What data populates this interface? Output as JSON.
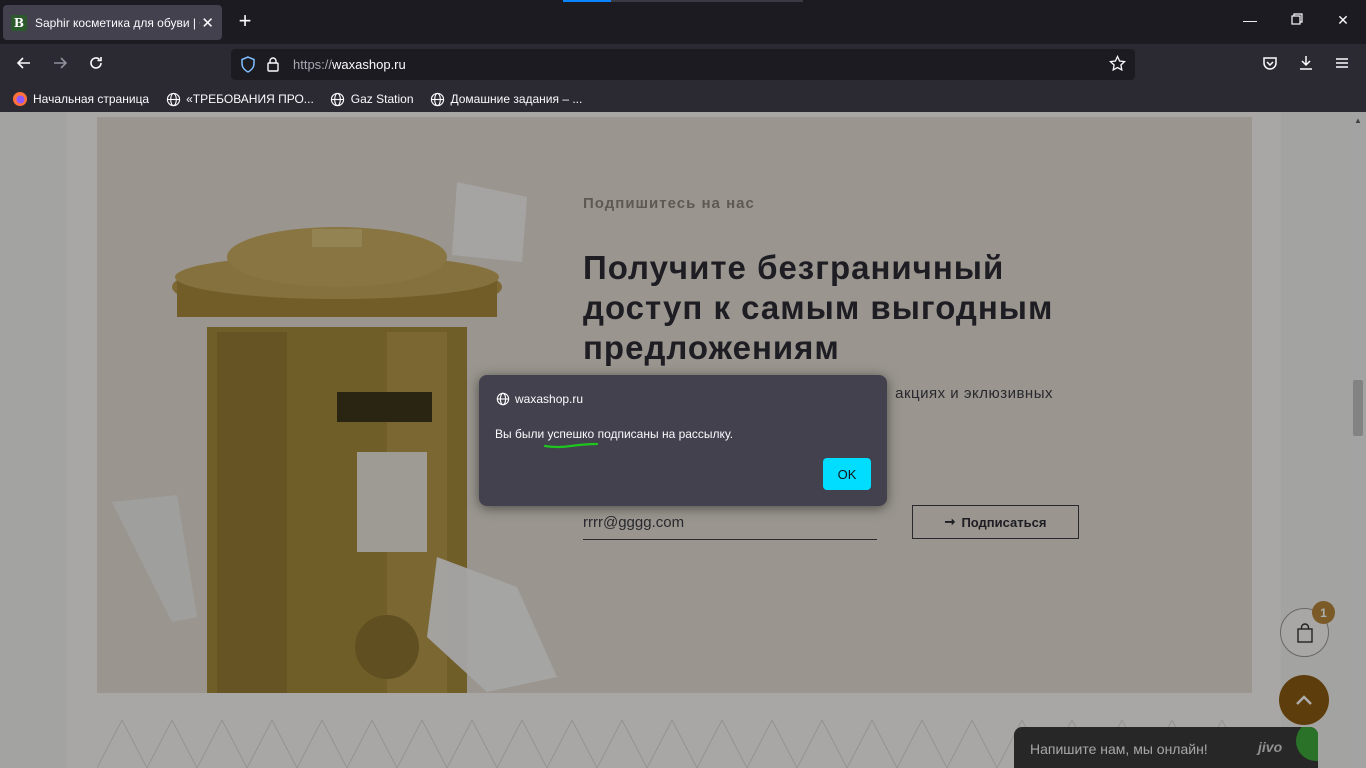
{
  "browser": {
    "tab": {
      "title": "Saphir косметика для обуви | О",
      "favicon_letter": "B"
    },
    "url": {
      "scheme": "https://",
      "host": "waxashop.ru"
    },
    "bookmarks": [
      {
        "label": "Начальная страница",
        "icon": "firefox-icon"
      },
      {
        "label": "«ТРЕБОВАНИЯ ПРО...",
        "icon": "globe-icon"
      },
      {
        "label": "Gaz Station",
        "icon": "globe-icon"
      },
      {
        "label": "Домашние задания – ...",
        "icon": "globe-icon"
      }
    ]
  },
  "promo": {
    "subtitle": "Подпишитесь на нас",
    "headline": "Получите безграничный доступ к самым выгодным предложениям",
    "description_visible": "акциях и эклюзивных",
    "email_value": "rrrr@gggg.com",
    "subscribe_label": "Подписаться",
    "subscribe_arrow": "➞"
  },
  "widgets": {
    "cart_count": "1",
    "chat_text": "Напишите нам, мы онлайн!",
    "chat_brand": "jivo"
  },
  "dialog": {
    "origin": "waxashop.ru",
    "message_before": "Вы были ",
    "message_highlight": "успешко",
    "message_after": " подписаны на рассылку.",
    "ok_label": "OK",
    "underline_color": "#1fc51f"
  },
  "colors": {
    "accent_ok": "#00ddff",
    "cart_badge": "#b5853b",
    "scroll_up": "#8b5a12",
    "chat_online": "#3fa93a"
  }
}
